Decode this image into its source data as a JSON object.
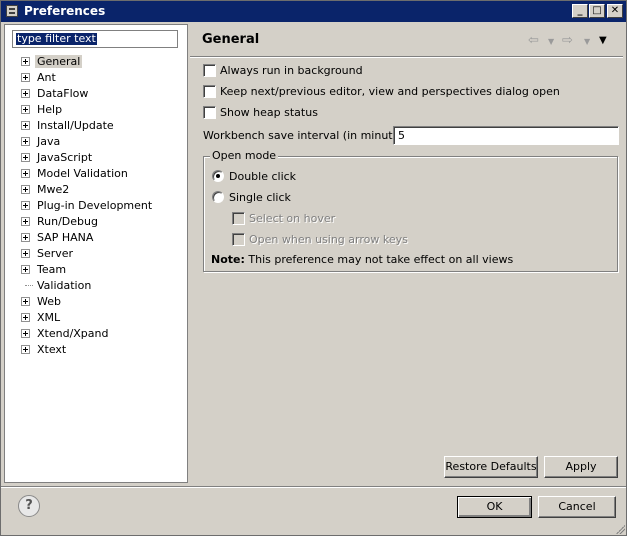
{
  "window": {
    "title": "Preferences",
    "icon": "preferences-icon",
    "minimize": "_",
    "maximize": "□",
    "close": "✕"
  },
  "filter": {
    "text": "type filter text"
  },
  "tree": {
    "items": [
      {
        "label": "General",
        "expandable": true,
        "selected": true
      },
      {
        "label": "Ant",
        "expandable": true
      },
      {
        "label": "DataFlow",
        "expandable": true
      },
      {
        "label": "Help",
        "expandable": true
      },
      {
        "label": "Install/Update",
        "expandable": true
      },
      {
        "label": "Java",
        "expandable": true
      },
      {
        "label": "JavaScript",
        "expandable": true
      },
      {
        "label": "Model Validation",
        "expandable": true
      },
      {
        "label": "Mwe2",
        "expandable": true
      },
      {
        "label": "Plug-in Development",
        "expandable": true
      },
      {
        "label": "Run/Debug",
        "expandable": true
      },
      {
        "label": "SAP HANA",
        "expandable": true
      },
      {
        "label": "Server",
        "expandable": true
      },
      {
        "label": "Team",
        "expandable": true
      },
      {
        "label": "Validation",
        "expandable": false
      },
      {
        "label": "Web",
        "expandable": true
      },
      {
        "label": "XML",
        "expandable": true
      },
      {
        "label": "Xtend/Xpand",
        "expandable": true
      },
      {
        "label": "Xtext",
        "expandable": true
      }
    ]
  },
  "page": {
    "title": "General",
    "nav": {
      "back": "⇦",
      "back_drop": "▼",
      "forward": "⇨",
      "forward_drop": "▼",
      "menu": "▼"
    },
    "options": {
      "always_run_background": "Always run in background",
      "keep_editor_dialog": "Keep next/previous editor, view and perspectives dialog open",
      "show_heap_status": "Show heap status"
    },
    "save_interval": {
      "label": "Workbench save interval (in minutes):",
      "value": "5"
    },
    "open_mode": {
      "title": "Open mode",
      "double_click": "Double click",
      "single_click": "Single click",
      "select_on_hover": "Select on hover",
      "open_arrow_keys": "Open when using arrow keys",
      "note_label": "Note:",
      "note_text": "This preference may not take effect on all views"
    },
    "restore_defaults": "Restore Defaults",
    "apply": "Apply"
  },
  "footer": {
    "help": "?",
    "ok": "OK",
    "cancel": "Cancel"
  },
  "colors": {
    "titlebar": "#0a246a",
    "dialog": "#d4d0c8",
    "selection": "#0a246a"
  }
}
